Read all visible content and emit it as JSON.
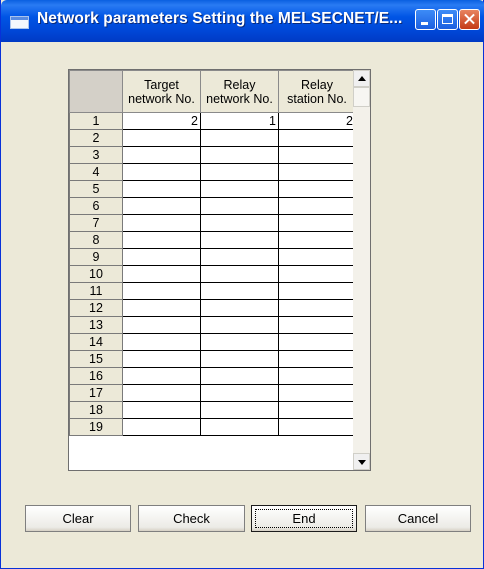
{
  "window": {
    "title": "Network parameters  Setting the MELSECNET/E..."
  },
  "controls": {
    "minimize": "minimize-icon",
    "maximize": "maximize-icon",
    "close": "close-icon"
  },
  "grid": {
    "columns": [
      "Target\nnetwork No.",
      "Relay\nnetwork No.",
      "Relay\nstation No."
    ],
    "rows": [
      {
        "num": "1",
        "target": "2",
        "relay_net": "1",
        "relay_station": "2"
      },
      {
        "num": "2",
        "target": "",
        "relay_net": "",
        "relay_station": ""
      },
      {
        "num": "3",
        "target": "",
        "relay_net": "",
        "relay_station": ""
      },
      {
        "num": "4",
        "target": "",
        "relay_net": "",
        "relay_station": ""
      },
      {
        "num": "5",
        "target": "",
        "relay_net": "",
        "relay_station": ""
      },
      {
        "num": "6",
        "target": "",
        "relay_net": "",
        "relay_station": ""
      },
      {
        "num": "7",
        "target": "",
        "relay_net": "",
        "relay_station": ""
      },
      {
        "num": "8",
        "target": "",
        "relay_net": "",
        "relay_station": ""
      },
      {
        "num": "9",
        "target": "",
        "relay_net": "",
        "relay_station": ""
      },
      {
        "num": "10",
        "target": "",
        "relay_net": "",
        "relay_station": ""
      },
      {
        "num": "11",
        "target": "",
        "relay_net": "",
        "relay_station": ""
      },
      {
        "num": "12",
        "target": "",
        "relay_net": "",
        "relay_station": ""
      },
      {
        "num": "13",
        "target": "",
        "relay_net": "",
        "relay_station": ""
      },
      {
        "num": "14",
        "target": "",
        "relay_net": "",
        "relay_station": ""
      },
      {
        "num": "15",
        "target": "",
        "relay_net": "",
        "relay_station": ""
      },
      {
        "num": "16",
        "target": "",
        "relay_net": "",
        "relay_station": ""
      },
      {
        "num": "17",
        "target": "",
        "relay_net": "",
        "relay_station": ""
      },
      {
        "num": "18",
        "target": "",
        "relay_net": "",
        "relay_station": ""
      },
      {
        "num": "19",
        "target": "",
        "relay_net": "",
        "relay_station": ""
      }
    ]
  },
  "buttons": {
    "clear": "Clear",
    "check": "Check",
    "end": "End",
    "cancel": "Cancel"
  },
  "colors": {
    "titlebar": "#0055e5",
    "dialog": "#ece9d8",
    "close": "#c43a17"
  }
}
